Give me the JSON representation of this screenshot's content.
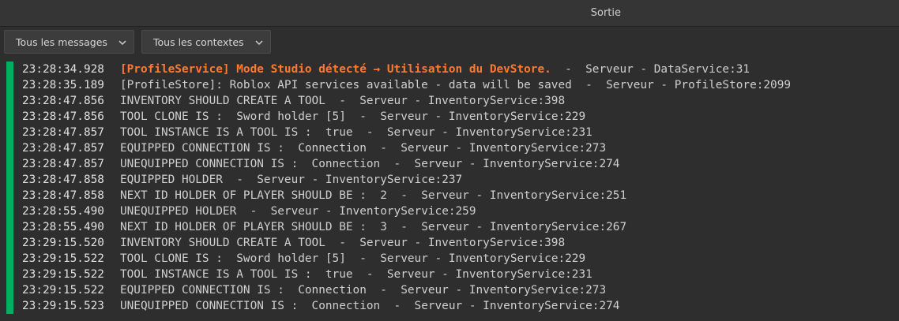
{
  "header": {
    "title": "Sortie"
  },
  "filters": {
    "messages_label": "Tous les messages",
    "contexts_label": "Tous les contextes"
  },
  "colors": {
    "accent_bar": "#00b060",
    "warning_text": "#ff7a30",
    "normal_text": "#cfcfcf"
  },
  "log": {
    "lines": [
      {
        "time": "23:28:34.928",
        "message": "[ProfileService] Mode Studio détecté → Utilisation du DevStore.",
        "source": "Serveur - DataService:31",
        "level": "warning"
      },
      {
        "time": "23:28:35.189",
        "message": "[ProfileStore]: Roblox API services available - data will be saved",
        "source": "Serveur - ProfileStore:2099",
        "level": "info"
      },
      {
        "time": "23:28:47.856",
        "message": "INVENTORY SHOULD CREATE A TOOL",
        "source": "Serveur - InventoryService:398",
        "level": "info"
      },
      {
        "time": "23:28:47.856",
        "message": "TOOL CLONE IS :  Sword holder [5]",
        "source": "Serveur - InventoryService:229",
        "level": "info"
      },
      {
        "time": "23:28:47.857",
        "message": "TOOL INSTANCE IS A TOOL IS :  true",
        "source": "Serveur - InventoryService:231",
        "level": "info"
      },
      {
        "time": "23:28:47.857",
        "message": "EQUIPPED CONNECTION IS :  Connection",
        "source": "Serveur - InventoryService:273",
        "level": "info"
      },
      {
        "time": "23:28:47.857",
        "message": "UNEQUIPPED CONNECTION IS :  Connection",
        "source": "Serveur - InventoryService:274",
        "level": "info"
      },
      {
        "time": "23:28:47.858",
        "message": "EQUIPPED HOLDER",
        "source": "Serveur - InventoryService:237",
        "level": "info"
      },
      {
        "time": "23:28:47.858",
        "message": "NEXT ID HOLDER OF PLAYER SHOULD BE :  2",
        "source": "Serveur - InventoryService:251",
        "level": "info"
      },
      {
        "time": "23:28:55.490",
        "message": "UNEQUIPPED HOLDER",
        "source": "Serveur - InventoryService:259",
        "level": "info"
      },
      {
        "time": "23:28:55.490",
        "message": "NEXT ID HOLDER OF PLAYER SHOULD BE :  3",
        "source": "Serveur - InventoryService:267",
        "level": "info"
      },
      {
        "time": "23:29:15.520",
        "message": "INVENTORY SHOULD CREATE A TOOL",
        "source": "Serveur - InventoryService:398",
        "level": "info"
      },
      {
        "time": "23:29:15.522",
        "message": "TOOL CLONE IS :  Sword holder [5]",
        "source": "Serveur - InventoryService:229",
        "level": "info"
      },
      {
        "time": "23:29:15.522",
        "message": "TOOL INSTANCE IS A TOOL IS :  true",
        "source": "Serveur - InventoryService:231",
        "level": "info"
      },
      {
        "time": "23:29:15.522",
        "message": "EQUIPPED CONNECTION IS :  Connection",
        "source": "Serveur - InventoryService:273",
        "level": "info"
      },
      {
        "time": "23:29:15.523",
        "message": "UNEQUIPPED CONNECTION IS :  Connection",
        "source": "Serveur - InventoryService:274",
        "level": "info"
      }
    ]
  }
}
